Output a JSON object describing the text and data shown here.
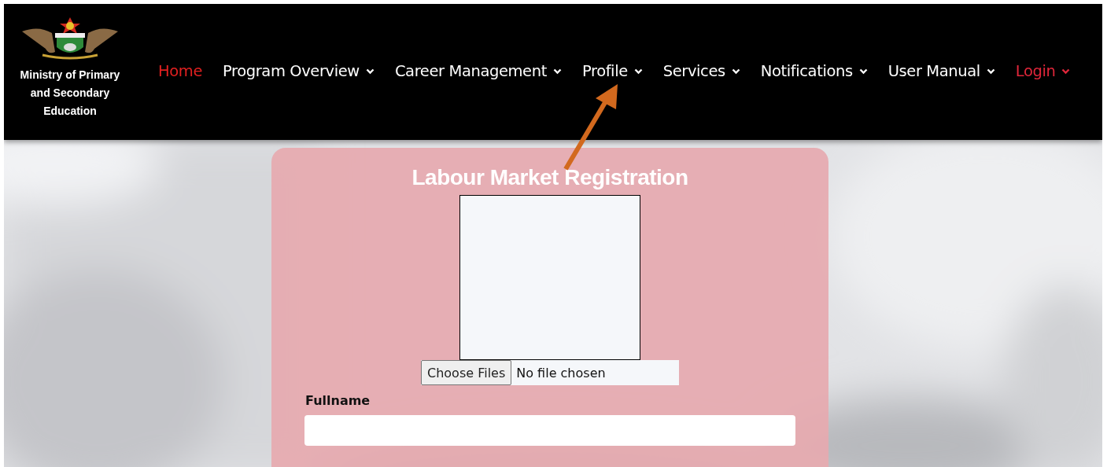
{
  "brand": {
    "name": "Ministry of Primary and Secondary Education"
  },
  "nav": [
    {
      "label": "Home",
      "color": "#e02020",
      "dropdown": false
    },
    {
      "label": "Program Overview",
      "color": "#ffffff",
      "dropdown": true
    },
    {
      "label": "Career Management",
      "color": "#ffffff",
      "dropdown": true
    },
    {
      "label": "Profile",
      "color": "#ffffff",
      "dropdown": true
    },
    {
      "label": "Services",
      "color": "#ffffff",
      "dropdown": true
    },
    {
      "label": "Notifications",
      "color": "#ffffff",
      "dropdown": true
    },
    {
      "label": "User Manual",
      "color": "#ffffff",
      "dropdown": true
    },
    {
      "label": "Login",
      "color": "#e0263a",
      "dropdown": true
    }
  ],
  "form": {
    "title": "Labour Market Registration",
    "file_input": {
      "button": "Choose Files",
      "status": "No file chosen"
    },
    "fields": [
      {
        "label": "Fullname"
      }
    ]
  }
}
